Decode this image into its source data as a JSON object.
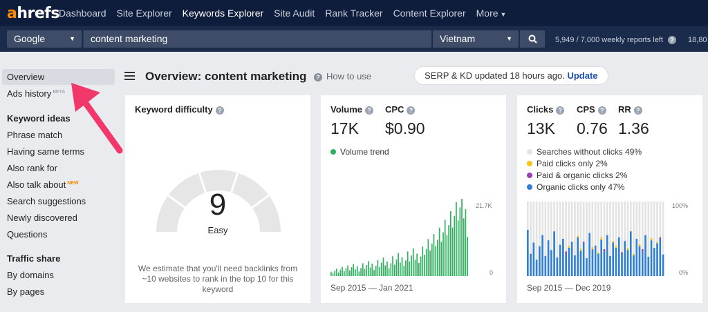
{
  "nav": {
    "logo_a": "a",
    "logo_rest": "hrefs",
    "items": [
      "Dashboard",
      "Site Explorer",
      "Keywords Explorer",
      "Site Audit",
      "Rank Tracker",
      "Content Explorer",
      "More"
    ]
  },
  "search": {
    "engine": "Google",
    "keyword": "content marketing",
    "country": "Vietnam",
    "reports": "5,949 / 7,000 weekly reports left",
    "credits": "18,80"
  },
  "sidebar": {
    "overview": "Overview",
    "ads_history": "Ads history",
    "beta": "BETA",
    "keyword_ideas": "Keyword ideas",
    "phrase_match": "Phrase match",
    "having_same_terms": "Having same terms",
    "also_rank_for": "Also rank for",
    "also_talk_about": "Also talk about",
    "new": "NEW",
    "search_suggestions": "Search suggestions",
    "newly_discovered": "Newly discovered",
    "questions": "Questions",
    "traffic_share": "Traffic share",
    "by_domains": "By domains",
    "by_pages": "By pages"
  },
  "header": {
    "title": "Overview: content marketing",
    "how_to_use": "How to use",
    "serp_text": "SERP & KD updated 18 hours ago.",
    "update": "Update"
  },
  "kd": {
    "title": "Keyword difficulty",
    "value": "9",
    "value_num": 9,
    "label": "Easy",
    "note": "We estimate that you'll need backlinks from ~10 websites to rank in the top 10 for this keyword"
  },
  "volume": {
    "volume_title": "Volume",
    "volume": "17K",
    "cpc_title": "CPC",
    "cpc": "$0.90",
    "legend": "Volume trend",
    "ymax": "21.7K",
    "ymin": "0",
    "dates": "Sep 2015 — Jan 2021"
  },
  "clicks": {
    "clicks_title": "Clicks",
    "clicks": "13K",
    "cps_title": "CPS",
    "cps": "0.76",
    "rr_title": "RR",
    "rr": "1.36",
    "legend": [
      {
        "label": "Searches without clicks 49%",
        "color": "#e3e3e3"
      },
      {
        "label": "Paid clicks only 2%",
        "color": "#f5c518"
      },
      {
        "label": "Paid & organic clicks 2%",
        "color": "#9b3fb5"
      },
      {
        "label": "Organic clicks only 47%",
        "color": "#2f7fd6"
      }
    ],
    "ymax": "100%",
    "ymin": "0%",
    "dates": "Sep 2015 — Dec 2019"
  },
  "colors": {
    "volume_green": "#2fb05f",
    "nav_bg": "#0f1d3c",
    "search_bg": "#1b2b4b"
  },
  "chart_data": [
    {
      "type": "bar",
      "title": "Volume trend",
      "ylim": [
        0,
        21700
      ],
      "values": [
        1200,
        800,
        1500,
        2100,
        1000,
        1800,
        2600,
        1400,
        2200,
        3000,
        1600,
        2500,
        3400,
        1900,
        2800,
        1300,
        2300,
        3600,
        2000,
        3100,
        4200,
        2400,
        3500,
        1700,
        2900,
        4500,
        2600,
        3800,
        5200,
        3000,
        4100,
        2200,
        3600,
        5600,
        3200,
        4700,
        6500,
        3800,
        5300,
        2900,
        4400,
        6900,
        4100,
        5800,
        7800,
        4600,
        6300,
        3700,
        5500,
        8300,
        6000,
        7600,
        10400,
        7200,
        9100,
        11800,
        8400,
        10200,
        13600,
        9600,
        12300,
        15800,
        11500,
        14300,
        18200,
        13600,
        16900,
        20800,
        15600,
        19300,
        21700,
        16200,
        18800,
        11000
      ]
    },
    {
      "type": "bar",
      "title": "",
      "ylim": [
        0,
        100
      ],
      "series": [
        {
          "name": "Organic clicks only",
          "values": [
            62,
            30,
            45,
            22,
            40,
            55,
            27,
            48,
            35,
            60,
            25,
            42,
            50,
            30,
            38,
            46,
            28,
            52,
            34,
            44,
            24,
            58,
            36,
            41,
            30,
            49,
            33,
            55,
            27,
            45,
            38,
            52,
            30,
            47,
            35,
            60,
            28,
            50,
            40,
            33,
            55,
            26,
            48,
            38,
            44,
            50,
            29
          ]
        },
        {
          "name": "Paid & organic clicks",
          "values": [
            0,
            0,
            0,
            0,
            0,
            0,
            0,
            0,
            0,
            0,
            0,
            0,
            0,
            3,
            0,
            0,
            0,
            0,
            0,
            2,
            0,
            0,
            0,
            0,
            0,
            0,
            3,
            0,
            0,
            0,
            0,
            0,
            2,
            0,
            0,
            0,
            0,
            0,
            0,
            3,
            0,
            0,
            0,
            0,
            0,
            2,
            0
          ]
        },
        {
          "name": "Paid clicks only",
          "values": [
            0,
            0,
            0,
            0,
            0,
            0,
            0,
            0,
            0,
            0,
            0,
            0,
            0,
            0,
            3,
            0,
            0,
            2,
            3,
            0,
            0,
            0,
            3,
            0,
            2,
            3,
            0,
            0,
            0,
            2,
            3,
            0,
            0,
            0,
            3,
            0,
            2,
            0,
            3,
            0,
            0,
            0,
            3,
            0,
            2,
            0,
            0
          ]
        }
      ]
    }
  ]
}
